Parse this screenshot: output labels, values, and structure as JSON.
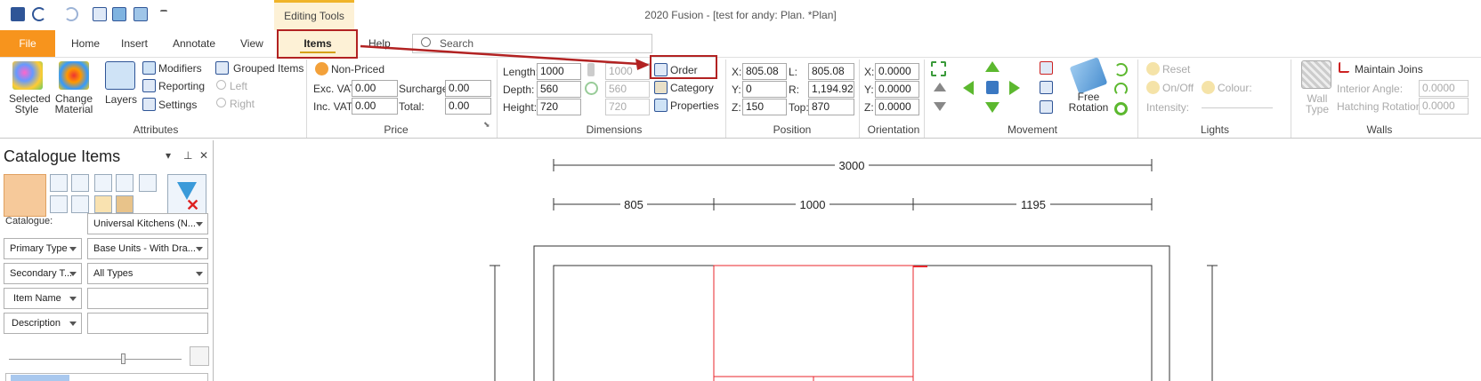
{
  "window": {
    "title": "2020 Fusion - [test for andy: Plan. *Plan]",
    "context_tab": "Editing Tools"
  },
  "tabs": [
    {
      "label": "File"
    },
    {
      "label": "Home"
    },
    {
      "label": "Insert"
    },
    {
      "label": "Annotate"
    },
    {
      "label": "View"
    },
    {
      "label": "Items"
    },
    {
      "label": "Help"
    }
  ],
  "search": {
    "placeholder": "Search"
  },
  "ribbon": {
    "attributes": {
      "label": "Attributes",
      "selected_style": "Selected Style",
      "change_material": "Change Material",
      "layers": "Layers",
      "modifiers": "Modifiers",
      "reporting": "Reporting",
      "settings": "Settings",
      "grouped_items": "Grouped Items",
      "left": "Left",
      "right": "Right"
    },
    "price": {
      "label": "Price",
      "non_priced": "Non-Priced",
      "exc_vat_label": "Exc. VAT:",
      "exc_vat": "0.00",
      "surcharge_label": "Surcharge:",
      "surcharge": "0.00",
      "inc_vat_label": "Inc. VAT:",
      "inc_vat": "0.00",
      "total_label": "Total:",
      "total": "0.00"
    },
    "dimensions": {
      "label": "Dimensions",
      "length_label": "Length:",
      "length": "1000",
      "length_ghost": "1000",
      "depth_label": "Depth:",
      "depth": "560",
      "depth_ghost": "560",
      "height_label": "Height:",
      "height": "720",
      "height_ghost": "720",
      "order": "Order",
      "category": "Category",
      "properties": "Properties"
    },
    "position": {
      "label": "Position",
      "x_label": "X:",
      "x": "805.08",
      "y_label": "Y:",
      "y": "0",
      "z_label": "Z:",
      "z": "150",
      "l_label": "L:",
      "l": "805.08",
      "r_label": "R:",
      "r": "1,194.92",
      "top_label": "Top:",
      "top": "870"
    },
    "orientation": {
      "label": "Orientation",
      "x_label": "X:",
      "x": "0.0000",
      "y_label": "Y:",
      "y": "0.0000",
      "z_label": "Z:",
      "z": "0.0000"
    },
    "movement": {
      "label": "Movement",
      "free_rotation": "Free Rotation"
    },
    "lights": {
      "label": "Lights",
      "reset": "Reset",
      "on_off": "On/Off",
      "colour": "Colour:",
      "intensity": "Intensity:"
    },
    "walls": {
      "label": "Walls",
      "maintain_joins": "Maintain Joins",
      "wall_type": "Wall Type",
      "interior_angle_label": "Interior Angle:",
      "interior_angle": "0.0000",
      "hatching_rotation_label": "Hatching Rotation:",
      "hatching_rotation": "0.0000"
    }
  },
  "panel": {
    "title": "Catalogue Items",
    "catalogue_label": "Catalogue:",
    "catalogue_value": "Universal Kitchens (N...",
    "primary_type_label": "Primary Type",
    "primary_type_value": "Base Units - With Dra...",
    "secondary_type_label": "Secondary T...",
    "secondary_type_value": "All Types",
    "item_name_label": "Item Name",
    "item_name_value": "",
    "description_label": "Description",
    "description_value": ""
  },
  "drawing": {
    "overall_dim": "3000",
    "segment_dims": [
      "805",
      "1000",
      "1195"
    ]
  },
  "colors": {
    "accent": "#f7941d",
    "highlight_box": "#b22222",
    "selection": "#e8262b"
  }
}
